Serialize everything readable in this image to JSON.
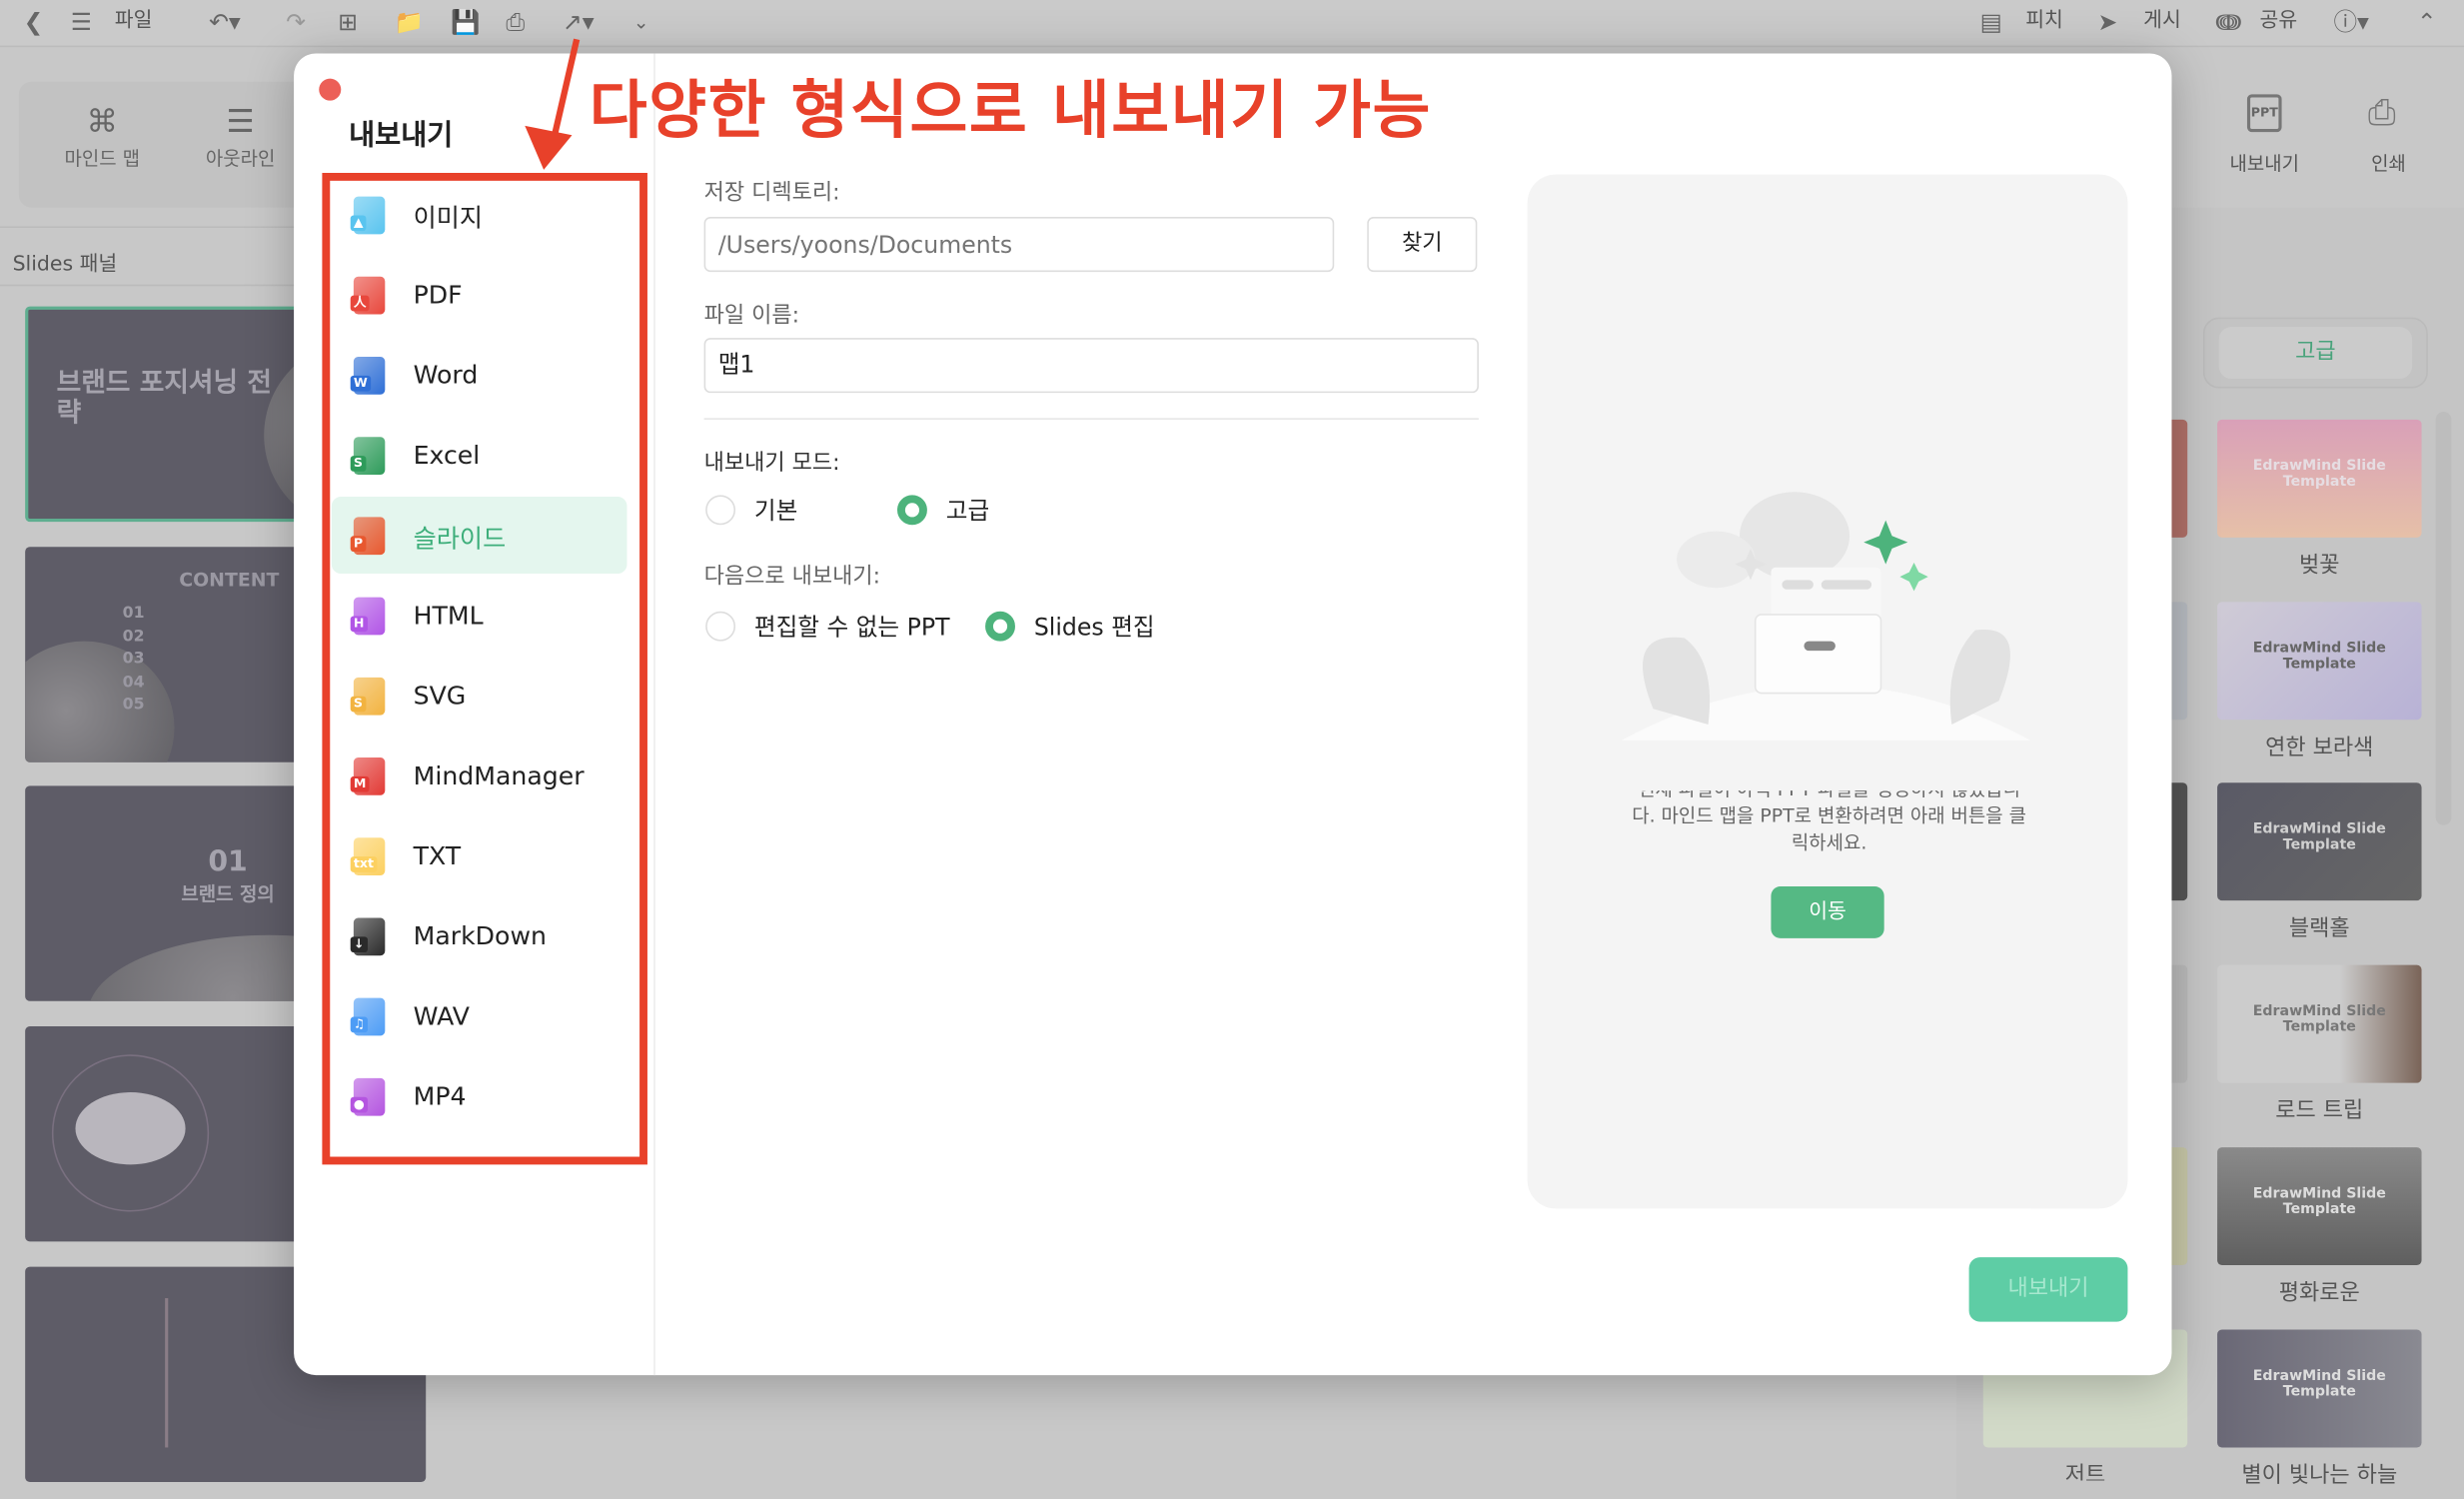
{
  "toolbar": {
    "file_label": "파일",
    "icons": [
      "back-icon",
      "menu-icon",
      "undo-icon",
      "redo-icon",
      "new-icon",
      "open-folder-icon",
      "save-icon",
      "print-icon",
      "export-icon",
      "more-icon"
    ],
    "right": [
      {
        "icon": "pitch-icon",
        "label": "피치"
      },
      {
        "icon": "publish-icon",
        "label": "게시"
      },
      {
        "icon": "share-icon",
        "label": "공유"
      }
    ],
    "help_icon": "help-icon",
    "collapse_icon": "chevron-up-icon"
  },
  "ribbon": {
    "items": [
      {
        "icon": "mindmap-icon",
        "label": "마인드 맵"
      },
      {
        "icon": "outline-icon",
        "label": "아웃라인"
      }
    ],
    "right_items": [
      {
        "icon": "ppt-icon",
        "label": "내보내기"
      },
      {
        "icon": "print-icon",
        "label": "인쇄"
      }
    ]
  },
  "slides_panel": {
    "title": "Slides 패널",
    "slides": [
      {
        "title": "브랜드 포지셔닝 전략"
      },
      {
        "title": "CONTENT",
        "numbers": [
          "01",
          "02",
          "03",
          "04",
          "05"
        ]
      },
      {
        "number": "01",
        "title": "브랜드 정의"
      },
      {},
      {}
    ]
  },
  "templates": {
    "tab": "고급",
    "items": [
      "벚꽃",
      "연한 보라색",
      "블랙홀",
      "로드 트립",
      "평화로운",
      "별이 빛나는 하늘"
    ],
    "partial_label": "저트",
    "thumb_text": "EdrawMind Slide Template"
  },
  "dialog": {
    "title": "내보내기",
    "formats": [
      "이미지",
      "PDF",
      "Word",
      "Excel",
      "슬라이드",
      "HTML",
      "SVG",
      "MindManager",
      "TXT",
      "MarkDown",
      "WAV",
      "MP4"
    ],
    "selected_format": "슬라이드",
    "dir_label": "저장 디렉토리:",
    "dir_placeholder": "/Users/yoons/Documents",
    "browse": "찾기",
    "name_label": "파일 이름:",
    "name_value": "맵1",
    "mode_label": "내보내기 모드:",
    "mode_options": [
      "기본",
      "고급"
    ],
    "mode_selected": "고급",
    "as_label": "다음으로 내보내기:",
    "as_options": [
      "편집할 수 없는 PPT",
      "Slides 편집"
    ],
    "as_selected": "Slides 편집",
    "preview_msg": "현재 파일이 아직 PPT 파일을 생성하지 않았습니다. 마인드 맵을 PPT로 변환하려면 아래 버튼을 클릭하세요.",
    "go_button": "이동",
    "export_button": "내보내기"
  },
  "annotation": {
    "text": "다양한 형식으로 내보내기 가능"
  },
  "colors": {
    "accent": "#4db37c",
    "annotation": "#e8412a",
    "export_btn": "#5ecda5"
  }
}
